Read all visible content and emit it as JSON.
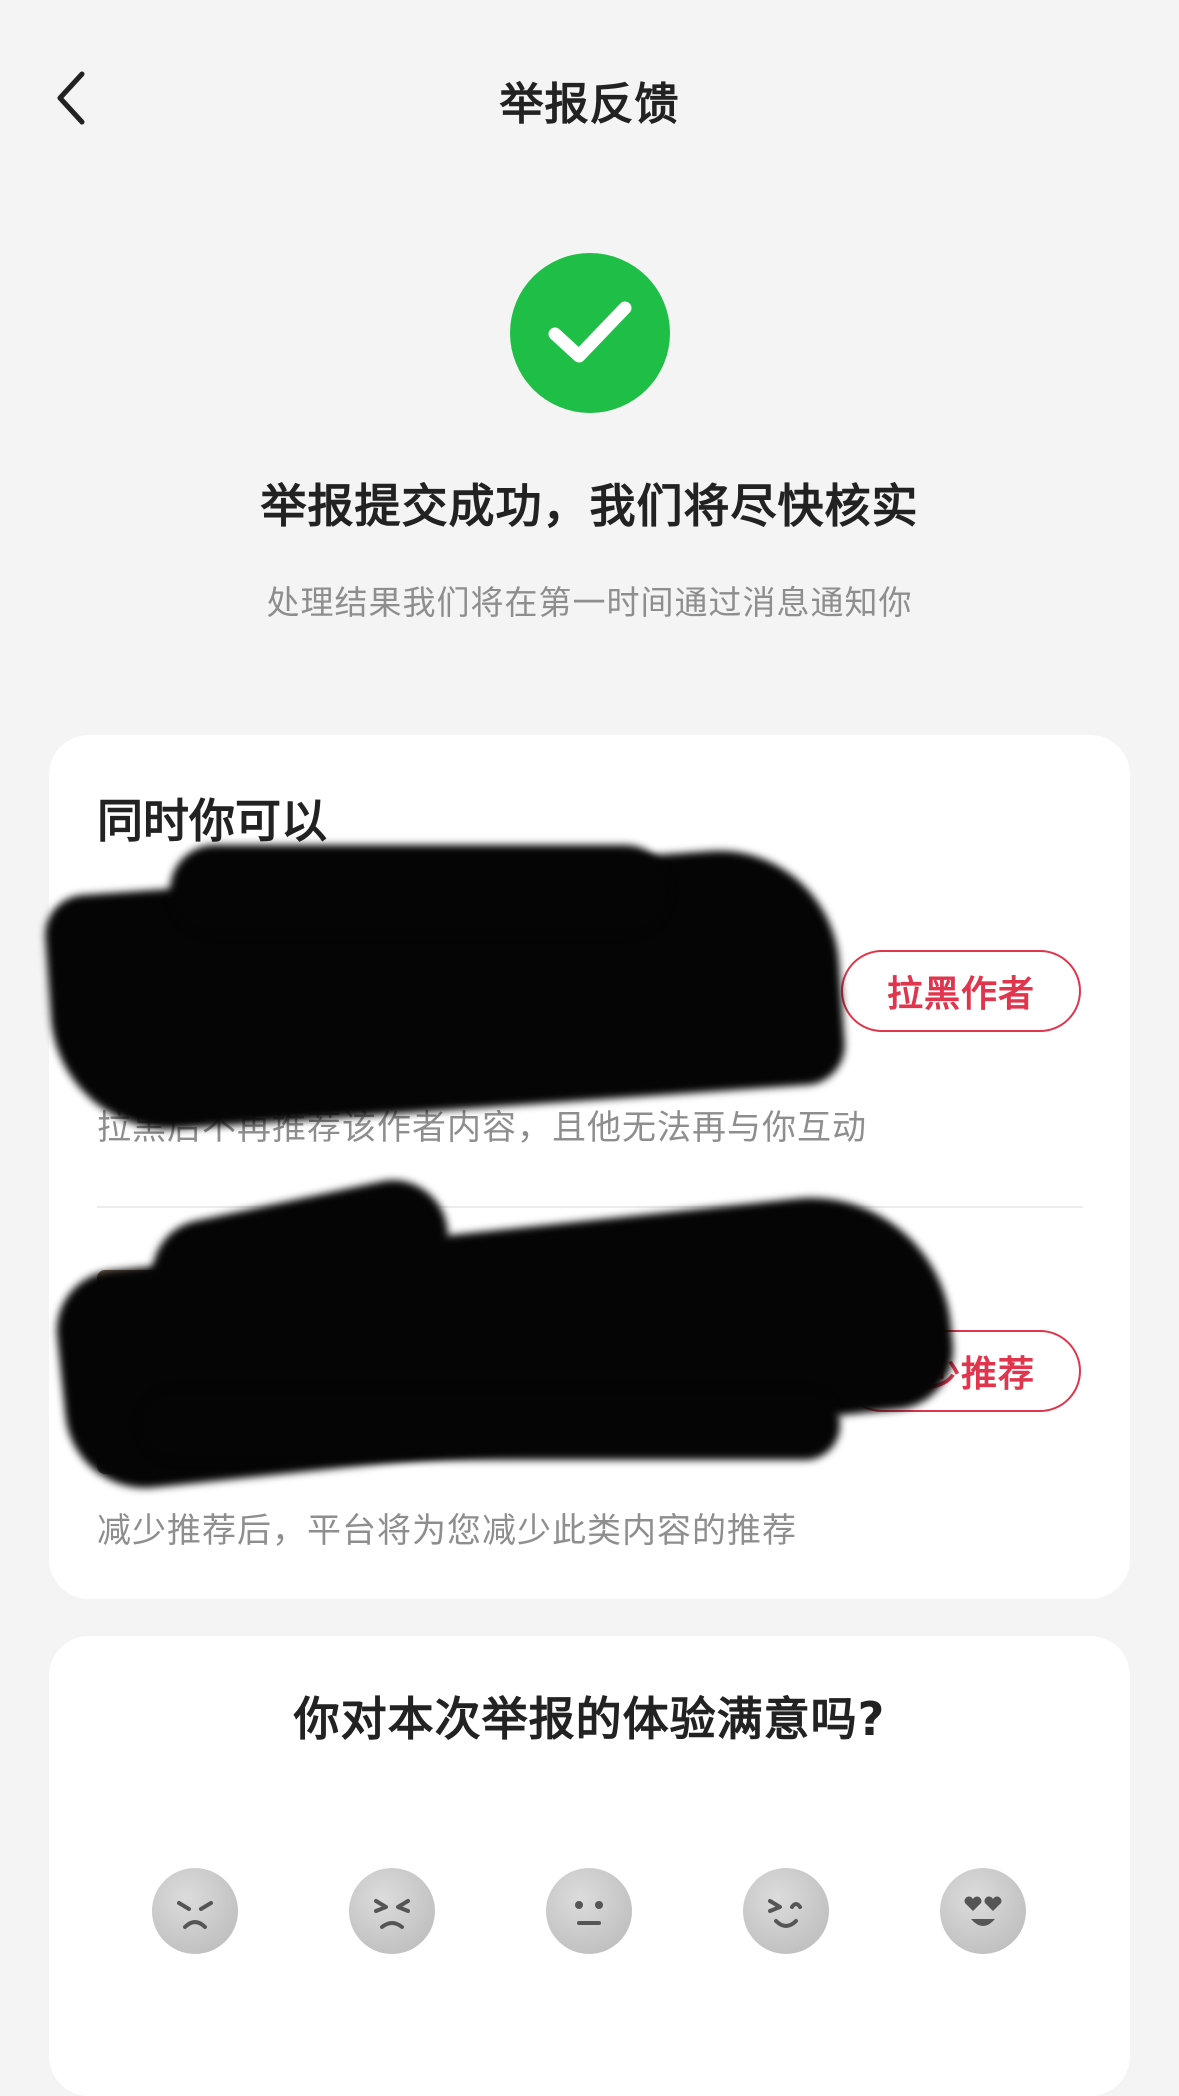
{
  "header": {
    "title": "举报反馈",
    "back_icon": "chevron-left-icon"
  },
  "success": {
    "icon": "check-circle-icon",
    "color": "#1fbe46",
    "title": "举报提交成功，我们将尽快核实",
    "subtitle": "处理结果我们将在第一时间通过消息通知你"
  },
  "actions": {
    "heading": "同时你可以",
    "items": [
      {
        "button_label": "拉黑作者",
        "description": "拉黑后不再推荐该作者内容，且他无法再与你互动"
      },
      {
        "button_label": "减少推荐",
        "description": "减少推荐后，平台将为您减少此类内容的推荐"
      }
    ],
    "accent_color": "#e0354c"
  },
  "survey": {
    "question": "你对本次举报的体验满意吗?",
    "options": [
      "very-dissatisfied-face-icon",
      "dissatisfied-face-icon",
      "neutral-face-icon",
      "satisfied-face-icon",
      "very-satisfied-face-icon"
    ]
  }
}
